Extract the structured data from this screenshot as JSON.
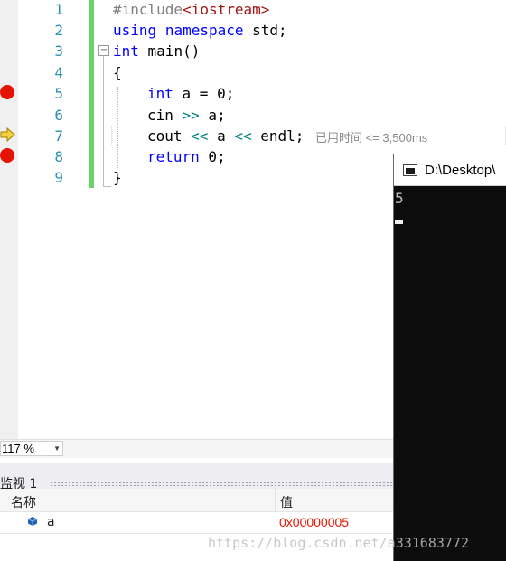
{
  "editor": {
    "line_numbers": [
      "1",
      "2",
      "3",
      "4",
      "5",
      "6",
      "7",
      "8",
      "9"
    ],
    "lines": {
      "l1_pp": "#include",
      "l1_inc": "<iostream>",
      "l2_kw1": "using",
      "l2_kw2": "namespace",
      "l2_rest": " std;",
      "l3_kw": "int",
      "l3_rest": " main()",
      "l4": "{",
      "l5_kw": "int",
      "l5_rest": " a = 0;",
      "l6_a": "cin ",
      "l6_op": ">>",
      "l6_b": " a;",
      "l7_a": "cout ",
      "l7_op1": "<<",
      "l7_b": " a ",
      "l7_op2": "<<",
      "l7_c": " endl;",
      "l8_kw": "return",
      "l8_rest": " 0;",
      "l9": "}"
    },
    "outline_toggle": "−",
    "perf_tip": "已用时间 <= 3,500ms",
    "breakpoint_lines": [
      5,
      8
    ],
    "instruction_pointer_line": 7
  },
  "zoom": {
    "value": "117 %"
  },
  "watch": {
    "title": "监视 1",
    "columns": {
      "name": "名称",
      "value": "值"
    },
    "rows": [
      {
        "name": "a",
        "value": "0x00000005"
      }
    ]
  },
  "console": {
    "title": "D:\\Desktop\\",
    "output": "5"
  },
  "watermark": "https://blog.csdn.net/a331683772",
  "colors": {
    "breakpoint": "#e51400",
    "line_number": "#2b91af",
    "keyword": "#0000ff",
    "change_bar": "#6ad36a",
    "changed_value": "#e51400"
  }
}
